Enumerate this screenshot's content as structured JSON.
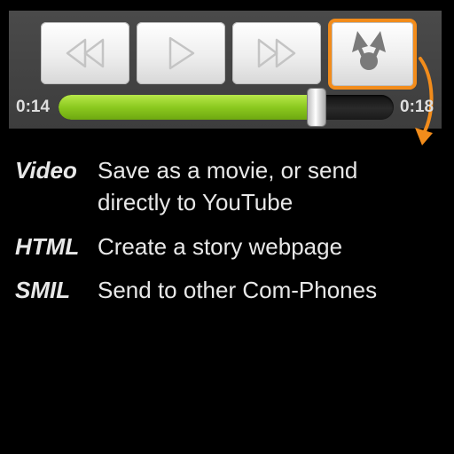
{
  "player": {
    "buttons": [
      {
        "name": "rewind",
        "icon": "rewind-icon"
      },
      {
        "name": "play",
        "icon": "play-icon"
      },
      {
        "name": "fast-forward",
        "icon": "fast-forward-icon"
      },
      {
        "name": "share",
        "icon": "share-export-icon",
        "highlighted": true
      }
    ],
    "current_time": "0:14",
    "total_time": "0:18",
    "progress": 0.77,
    "colors": {
      "highlight": "#f28c1b",
      "progress_fill": "#8bc91f"
    }
  },
  "options": [
    {
      "term": "Video",
      "description": "Save as a movie, or send directly to YouTube"
    },
    {
      "term": "HTML",
      "description": "Create a story webpage"
    },
    {
      "term": "SMIL",
      "description": "Send to other Com-Phones"
    }
  ]
}
